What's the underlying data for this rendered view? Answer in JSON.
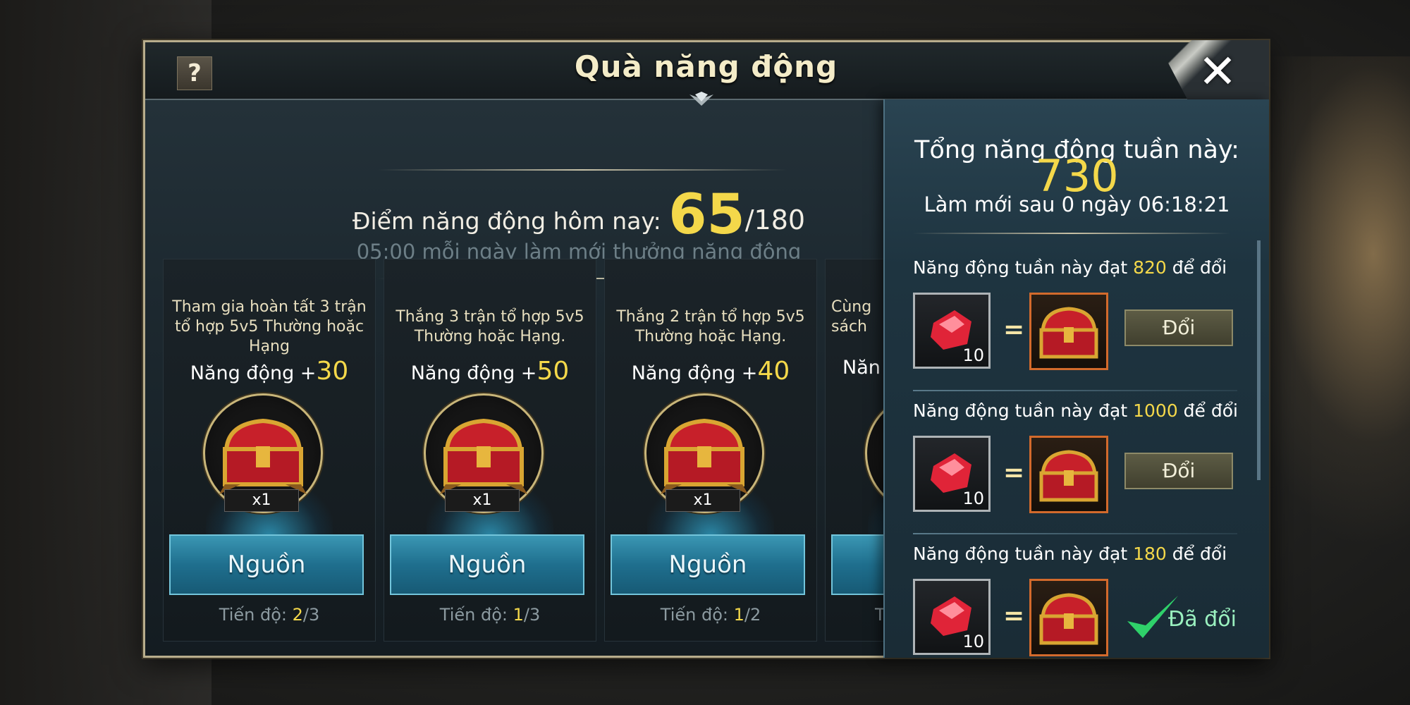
{
  "window": {
    "title": "Quà năng động",
    "help_label": "?",
    "close_label": "✕"
  },
  "daily": {
    "label": "Điểm năng động hôm nay:",
    "score": "65",
    "max": "/180",
    "refresh_note": "05:00 mỗi ngày làm mới thưởng năng động"
  },
  "tasks": [
    {
      "desc": "Tham gia hoàn tất 3 trận tổ hợp 5v5 Thường hoặc Hạng",
      "points_label": "Năng động +",
      "points": "30",
      "qty": "x1",
      "button": "Nguồn",
      "progress_label": "Tiến độ: ",
      "progress_cur": "2",
      "progress_max": "/3"
    },
    {
      "desc": "Thắng 3 trận tổ hợp 5v5 Thường hoặc Hạng.",
      "points_label": "Năng động +",
      "points": "50",
      "qty": "x1",
      "button": "Nguồn",
      "progress_label": "Tiến độ: ",
      "progress_cur": "1",
      "progress_max": "/3"
    },
    {
      "desc": "Thắng 2 trận tổ hợp 5v5 Thường hoặc Hạng.",
      "points_label": "Năng động +",
      "points": "40",
      "qty": "x1",
      "button": "Nguồn",
      "progress_label": "Tiến độ: ",
      "progress_cur": "1",
      "progress_max": "/2"
    },
    {
      "desc": "Cùng sách",
      "points_label": "Năn",
      "points": "",
      "qty": "",
      "button": "",
      "progress_label": "T",
      "progress_cur": "",
      "progress_max": ""
    }
  ],
  "weekly": {
    "title": "Tổng năng động tuần này:",
    "total": "730",
    "refresh": "Làm mới sau 0 ngày 06:18:21",
    "tiers": [
      {
        "label_pre": "Năng động tuần này đạt ",
        "requirement": "820",
        "label_post": " để đổi",
        "gem_count": "10",
        "eq": "=",
        "action": "Đổi",
        "redeemed": false
      },
      {
        "label_pre": "Năng động tuần này đạt ",
        "requirement": "1000",
        "label_post": " để đổi",
        "gem_count": "10",
        "eq": "=",
        "action": "Đổi",
        "redeemed": false
      },
      {
        "label_pre": "Năng động tuần này đạt ",
        "requirement": "180",
        "label_post": " để đổi",
        "gem_count": "10",
        "eq": "=",
        "action": "Đã đổi",
        "redeemed": true
      }
    ]
  },
  "colors": {
    "accent_yellow": "#f4d84a",
    "button_blue": "#1f6f8e",
    "button_olive": "#4d4c39",
    "chest_border": "#d36a2c",
    "check_green": "#2fd16a"
  },
  "icons": {
    "help": "question-mark-icon",
    "close": "close-icon",
    "chest": "treasure-chest-icon",
    "gem": "red-gem-icon",
    "check": "checkmark-icon"
  }
}
